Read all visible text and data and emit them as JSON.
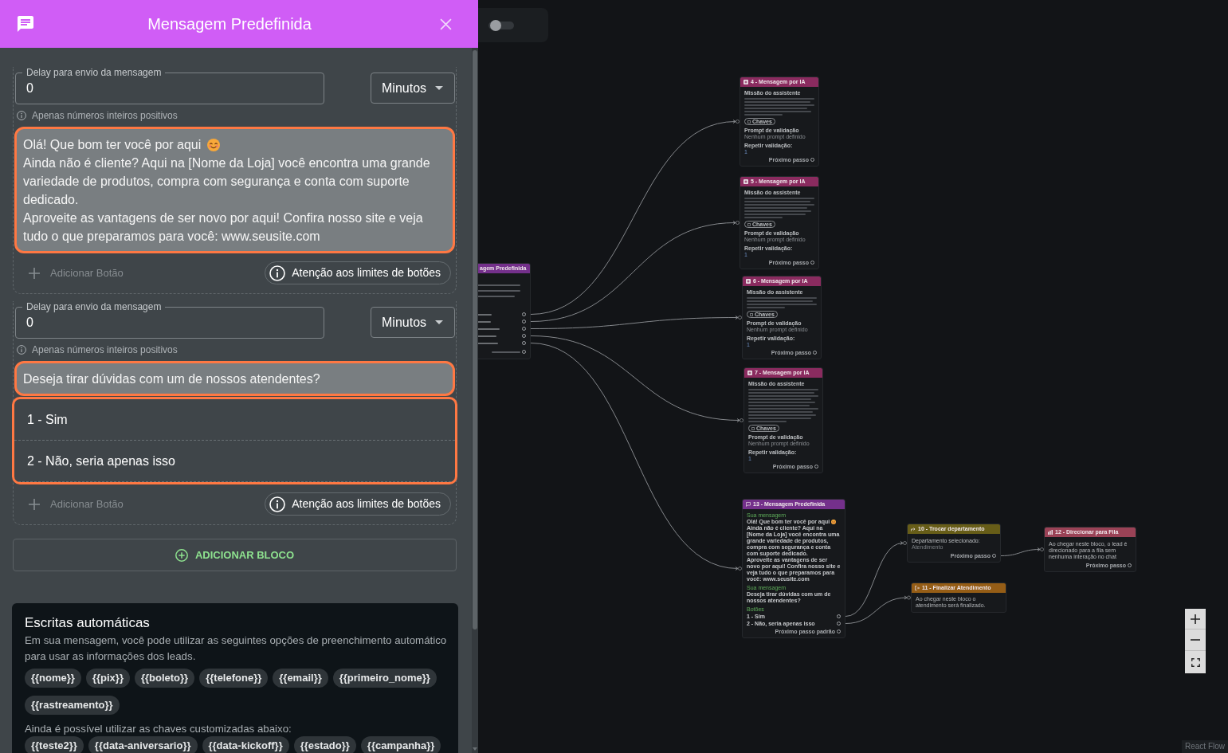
{
  "panel": {
    "title": "Mensagem Predefinida",
    "blocks": [
      {
        "delay": {
          "label": "Delay para envio da mensagem",
          "value": "0",
          "unit": "Minutos",
          "helper_text": "Apenas números inteiros positivos"
        },
        "message": [
          {
            "text": "Olá! Que bom ter você por aqui",
            "emoji": true
          },
          {
            "text": "Ainda não é cliente? Aqui na [Nome da Loja] você encontra uma grande variedade de produtos, compra com segurança e conta com suporte dedicado.",
            "emoji": false
          },
          {
            "text": "Aproveite as vantagens de ser novo por aqui! Confira nosso site e veja tudo o que preparamos para você: www.seusite.com",
            "emoji": false
          }
        ],
        "add_button": "Adicionar Botão",
        "limit_notice": "Atenção aos limites de botões"
      },
      {
        "delay": {
          "label": "Delay para envio da mensagem",
          "value": "0",
          "unit": "Minutos",
          "helper_text": "Apenas números inteiros positivos"
        },
        "message": [
          {
            "text": "Deseja tirar dúvidas com um de nossos atendentes?",
            "emoji": false
          }
        ],
        "options": [
          "1 - Sim",
          "2 - Não, seria apenas isso"
        ],
        "add_button": "Adicionar Botão",
        "limit_notice": "Atenção aos limites de botões"
      }
    ],
    "add_block": "ADICIONAR BLOCO",
    "auto_fill": {
      "title": "Escritas automáticas",
      "description": "Em sua mensagem, você pode utilizar as seguintes opções de preenchimento automático para usar as informações dos leads.",
      "keys": [
        "{{nome}}",
        "{{pix}}",
        "{{boleto}}",
        "{{telefone}}",
        "{{email}}",
        "{{primeiro_nome}}",
        "{{rastreamento}}"
      ],
      "custom_label": "Ainda é possível utilizar as chaves customizadas abaixo:",
      "custom_keys": [
        "{{teste2}}",
        "{{data-aniversario}}",
        "{{data-kickoff}}",
        "{{estado}}",
        "{{campanha}}"
      ]
    }
  },
  "canvas": {
    "toggle": {
      "on": false
    },
    "nodes": [
      {
        "kind": "clipped_message",
        "title": "agem Predefinida"
      },
      {
        "kind": "ai_message",
        "title": "4 - Mensagem por IA",
        "mission_label": "Missão do assistente",
        "chip": "Chaves",
        "prompt_label": "Prompt de validação",
        "prompt": "Nenhum prompt definido",
        "repeat_label": "Repetir validação:",
        "repeat": "1",
        "next": "Próximo passo"
      },
      {
        "kind": "ai_message",
        "title": "5 - Mensagem por IA",
        "mission_label": "Missão do assistente",
        "chip": "Chaves",
        "prompt_label": "Prompt de validação",
        "prompt": "Nenhum prompt definido",
        "repeat_label": "Repetir validação:",
        "repeat": "1",
        "next": "Próximo passo"
      },
      {
        "kind": "ai_message",
        "title": "6 - Mensagem por IA",
        "mission_label": "Missão do assistente",
        "chip": "Chaves",
        "prompt_label": "Prompt de validação",
        "prompt": "Nenhum prompt definido",
        "repeat_label": "Repetir validação:",
        "repeat": "1",
        "next": "Próximo passo"
      },
      {
        "kind": "ai_message",
        "title": "7 - Mensagem por IA",
        "mission_label": "Missão do assistente",
        "chip": "Chaves",
        "prompt_label": "Prompt de validação",
        "prompt": "Nenhum prompt definido",
        "repeat_label": "Repetir validação:",
        "repeat": "1",
        "next": "Próximo passo"
      },
      {
        "kind": "predefined_message",
        "title": "13 - Mensagem Predefinida",
        "messages": [
          {
            "label": "Sua mensagem",
            "paragraphs": [
              {
                "text": "Olá! Que bom ter você por aqui",
                "emoji": true
              },
              {
                "text": "Ainda não é cliente? Aqui na [Nome da Loja] você encontra uma grande variedade de produtos, compra com segurança e conta com suporte dedicado.",
                "emoji": false
              },
              {
                "text": "Aproveite as vantagens de ser novo por aqui! Confira nosso site e veja tudo o que preparamos para você: www.seusite.com",
                "emoji": false
              }
            ]
          },
          {
            "label": "Sua mensagem",
            "paragraphs": [
              {
                "text": "Deseja tirar dúvidas com um de nossos atendentes?",
                "emoji": false
              }
            ]
          }
        ],
        "buttons_label": "Botões",
        "buttons": [
          "1 - Sim",
          "2 - Não, seria apenas isso"
        ],
        "next": "Próximo passo padrão"
      },
      {
        "kind": "change_department",
        "title": "10 - Trocar departamento",
        "label": "Departamento selecionado:",
        "value": "Atendimento",
        "next": "Próximo passo"
      },
      {
        "kind": "finish",
        "title": "11 - Finalizar Atendimento",
        "text": "Ao chegar neste bloco o atendimento será finalizado."
      },
      {
        "kind": "queue",
        "title": "12 - Direcionar para Fila",
        "text": "Ao chegar neste bloco, o lead é direcionado para a fila sem nenhuma interação no chat",
        "next": "Próximo passo"
      }
    ],
    "attribution": "React Flow"
  }
}
